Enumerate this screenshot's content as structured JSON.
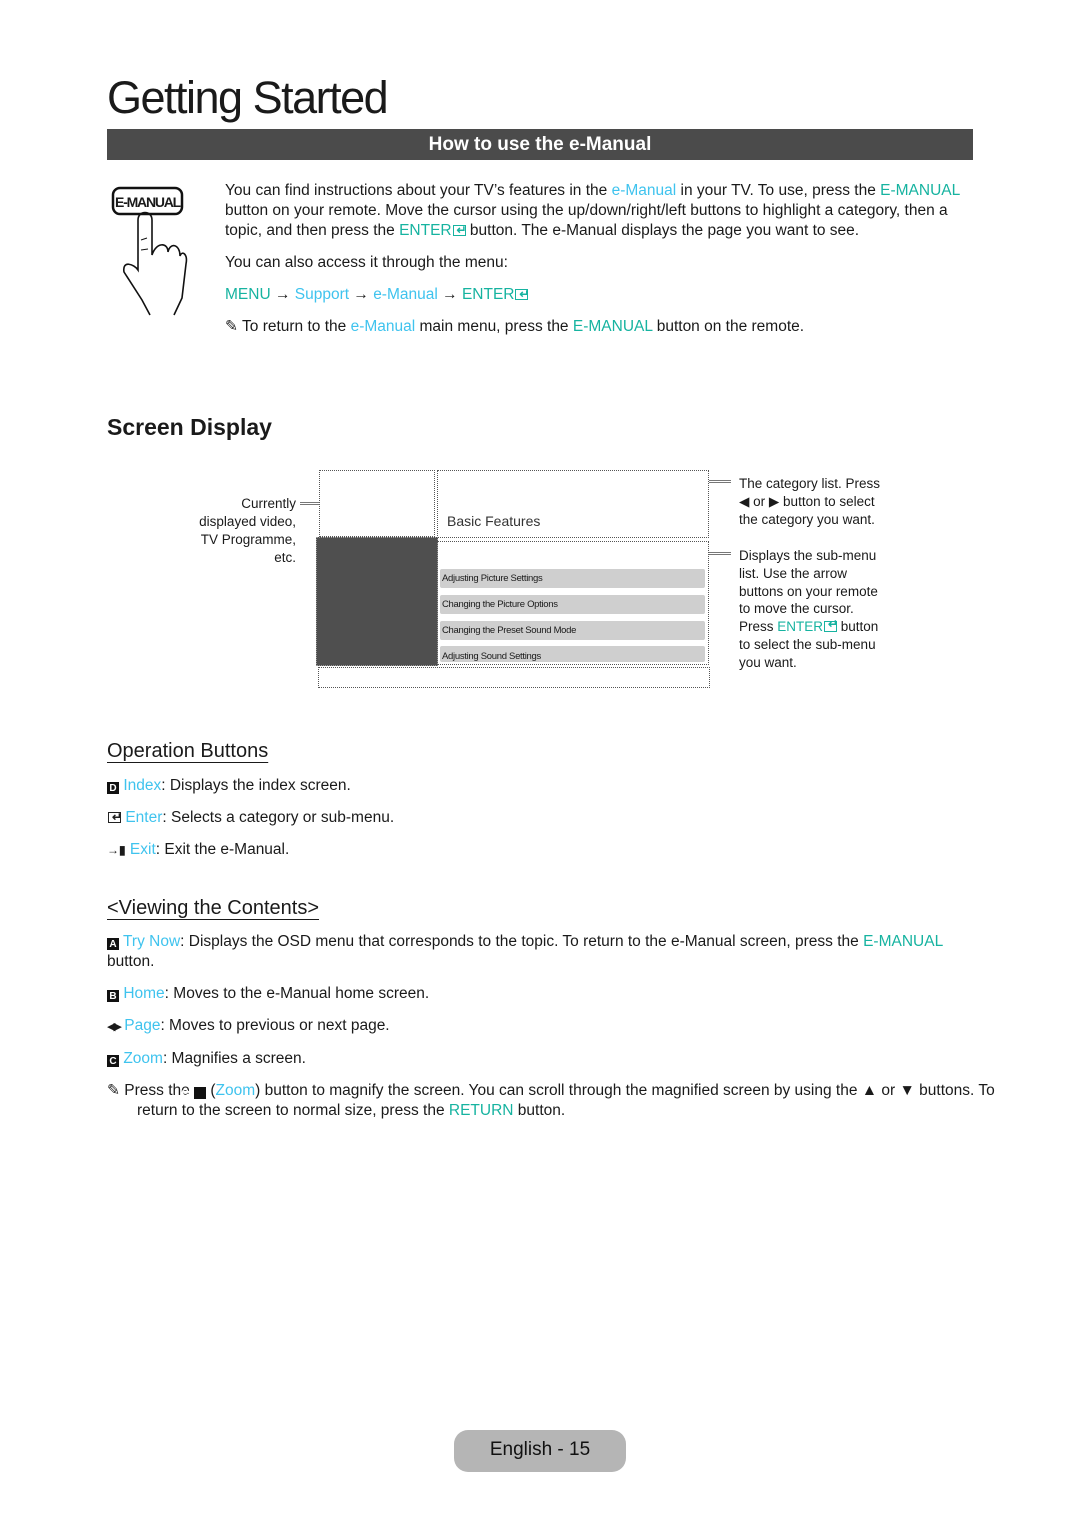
{
  "chapter_title": "Getting Started",
  "section_bar": "How to use the e-Manual",
  "remote_button_label": "E-MANUAL",
  "intro": {
    "p1": [
      {
        "t": "You can find instructions about your TV’s features in the ",
        "c": ""
      },
      {
        "t": "e-Manual",
        "c": "cyan"
      },
      {
        "t": " in your TV. To use, press the ",
        "c": ""
      },
      {
        "t": "E-MANUAL",
        "c": "teal"
      },
      {
        "t": " button on your remote. Move the cursor using the up/down/right/left buttons to highlight a category, then a topic, and then press the ",
        "c": ""
      },
      {
        "t": "ENTER",
        "c": "teal",
        "enter_icon": true
      },
      {
        "t": " button. The e-Manual displays the page you want to see.",
        "c": ""
      }
    ],
    "p2": "You can also access it through the menu:",
    "menu_path": [
      {
        "t": "MENU",
        "c": "teal"
      },
      {
        "t": " → ",
        "c": ""
      },
      {
        "t": "Support",
        "c": "cyan"
      },
      {
        "t": " → ",
        "c": ""
      },
      {
        "t": "e-Manual",
        "c": "cyan"
      },
      {
        "t": " → ",
        "c": ""
      },
      {
        "t": "ENTER",
        "c": "teal",
        "enter_icon": true
      }
    ],
    "note": [
      {
        "t": "✎ To return to the ",
        "c": ""
      },
      {
        "t": "e-Manual",
        "c": "cyan"
      },
      {
        "t": " main menu, press the ",
        "c": ""
      },
      {
        "t": "E-MANUAL",
        "c": "teal"
      },
      {
        "t": " button on the remote.",
        "c": ""
      }
    ]
  },
  "screen_display": {
    "heading": "Screen Display",
    "left_callout": [
      "Currently",
      "displayed video,",
      "TV Programme,",
      "etc."
    ],
    "category": "Basic Features",
    "submenu_items": [
      "Adjusting Picture Settings",
      "Changing the Picture Options",
      "Changing the Preset Sound Mode",
      "Adjusting Sound Settings"
    ],
    "callout_category": [
      {
        "t": "The category list. Press ",
        "c": ""
      },
      {
        "t": "◀",
        "c": ""
      },
      {
        "t": " or ",
        "c": ""
      },
      {
        "t": "▶",
        "c": ""
      },
      {
        "t": " button to select the category you want.",
        "c": ""
      }
    ],
    "callout_submenu": [
      {
        "t": "Displays the sub-menu list. Use the arrow buttons on your remote to move the cursor. Press ",
        "c": ""
      },
      {
        "t": "ENTER",
        "c": "teal",
        "enter_icon": true
      },
      {
        "t": " button to select the sub-menu you want.",
        "c": ""
      }
    ]
  },
  "operation_buttons": {
    "heading": "Operation Buttons",
    "items": [
      {
        "icon": "index-d-icon",
        "glyph": "D",
        "label": "Index",
        "desc": ": Displays the index screen."
      },
      {
        "icon": "enter-icon",
        "glyph": "",
        "label": "Enter",
        "desc": ": Selects a category or sub-menu."
      },
      {
        "icon": "exit-icon",
        "glyph": "→▮",
        "label": "Exit",
        "desc": ": Exit the e-Manual."
      }
    ]
  },
  "viewing_contents": {
    "heading": "<Viewing the Contents>",
    "try_now": {
      "glyph": "A",
      "label": "Try Now",
      "desc": ": Displays the OSD menu that corresponds to the topic. To return to the e-Manual screen, press the ",
      "button": "E-MANUAL",
      "tail": " button."
    },
    "home": {
      "glyph": "B",
      "label": "Home",
      "desc": ": Moves to the e-Manual home screen."
    },
    "page": {
      "glyph": "◀▶",
      "label": "Page",
      "desc": ": Moves to previous or next page."
    },
    "zoom": {
      "glyph": "C",
      "label": "Zoom",
      "desc": ": Magnifies a screen."
    },
    "note": [
      {
        "t": "✎ Press the ",
        "c": ""
      },
      {
        "t": "C",
        "c": "key"
      },
      {
        "t": " (",
        "c": ""
      },
      {
        "t": "Zoom",
        "c": "cyan"
      },
      {
        "t": ") button to magnify the screen. You can scroll through the magnified screen by using the ▲ or ▼ buttons. To return to the screen to normal size, press the ",
        "c": ""
      },
      {
        "t": "RETURN",
        "c": "teal"
      },
      {
        "t": " button.",
        "c": ""
      }
    ]
  },
  "footer": "English - 15",
  "colors": {
    "teal": "#16b3a0",
    "cyan": "#3fc3ee",
    "bar": "#4b4b4b",
    "video_area": "#4f4f4f",
    "submenu_item": "#cfcfcf",
    "footer_pill": "#b5b5b5"
  }
}
